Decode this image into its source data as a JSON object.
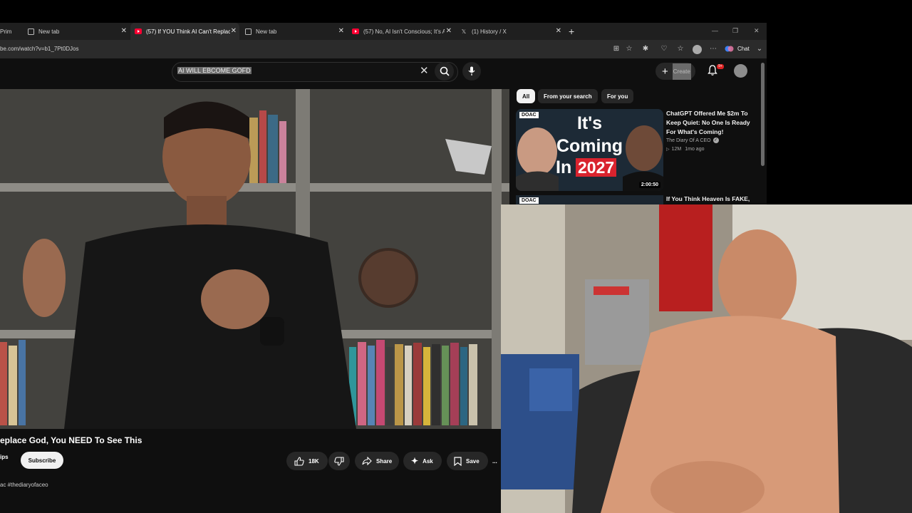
{
  "browser": {
    "tabs": [
      {
        "label": "Prim",
        "icon": "page-icon",
        "active": false
      },
      {
        "label": "New tab",
        "icon": "page-icon",
        "active": false
      },
      {
        "label": "(57) If YOU Think AI Can't Replace",
        "icon": "youtube-icon",
        "active": true
      },
      {
        "label": "New tab",
        "icon": "page-icon",
        "active": false
      },
      {
        "label": "(57) No, AI Isn't Conscious; It's Act",
        "icon": "youtube-icon",
        "active": false
      },
      {
        "label": "(1) History / X",
        "icon": "x-logo-icon",
        "active": false
      }
    ],
    "new_tab_symbol": "+",
    "url": "be.com/watch?v=b1_7Pt0DJos",
    "chat_label": "Chat"
  },
  "youtube": {
    "search_query": "AI WILL EBCOME GOFD",
    "create_label": "Create",
    "notification_count": "9+",
    "video": {
      "title": "eplace God, You NEED To See This",
      "channel_fragment": "ips",
      "subscribe_label": "Subscribe",
      "likes": "18K",
      "share_label": "Share",
      "ask_label": "Ask",
      "save_label": "Save",
      "more_label": "...",
      "description": "ac #thediaryofaceo"
    },
    "chips": [
      "All",
      "From your search",
      "For you"
    ],
    "related": [
      {
        "title": "ChatGPT Offered Me $2m To Keep Quiet: No One Is Ready For What's Coming!",
        "channel": "The Diary Of A CEO",
        "views": "12M",
        "age": "1mo ago",
        "duration": "2:00:50",
        "badge": "DOAC",
        "thumb_line1": "It's",
        "thumb_line2": "Coming",
        "thumb_line3": "In",
        "thumb_year": "2027"
      },
      {
        "title": "If You Think Heaven Is FAKE,",
        "badge": "DOAC"
      }
    ]
  },
  "colors": {
    "youtube_red": "#ff0033",
    "accent_red": "#d9232e",
    "page_bg": "#0f0f0f",
    "chip_bg": "#272727"
  }
}
